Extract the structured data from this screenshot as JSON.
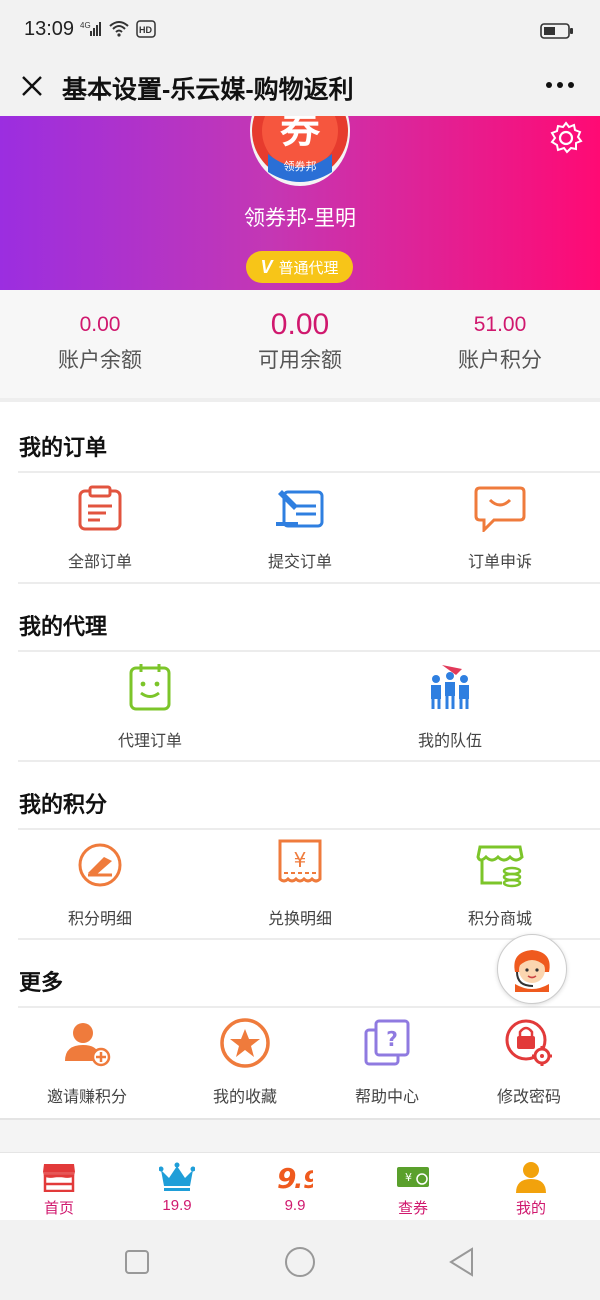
{
  "status_bar": {
    "time": "13:09",
    "network": "4G"
  },
  "nav": {
    "title": "基本设置-乐云媒-购物返利"
  },
  "profile": {
    "avatar_text": "券",
    "avatar_caption": "领券邦",
    "username": "领券邦-里明",
    "level_icon": "V",
    "level": "普通代理"
  },
  "stats": [
    {
      "value": "0.00",
      "label": "账户余额"
    },
    {
      "value": "0.00",
      "label": "可用余额"
    },
    {
      "value": "51.00",
      "label": "账户积分"
    }
  ],
  "orders": {
    "title": "我的订单",
    "items": [
      {
        "label": "全部订单",
        "icon": "clipboard-icon"
      },
      {
        "label": "提交订单",
        "icon": "submit-order-icon"
      },
      {
        "label": "订单申诉",
        "icon": "chat-bubble-icon"
      }
    ]
  },
  "agent": {
    "title": "我的代理",
    "items": [
      {
        "label": "代理订单",
        "icon": "agent-order-icon"
      },
      {
        "label": "我的队伍",
        "icon": "team-icon"
      }
    ]
  },
  "points": {
    "title": "我的积分",
    "items": [
      {
        "label": "积分明细",
        "icon": "points-detail-icon"
      },
      {
        "label": "兑换明细",
        "icon": "yen-ticket-icon"
      },
      {
        "label": "积分商城",
        "icon": "store-icon"
      }
    ]
  },
  "more": {
    "title": "更多",
    "items": [
      {
        "label": "邀请赚积分",
        "icon": "invite-user-icon"
      },
      {
        "label": "我的收藏",
        "icon": "star-icon"
      },
      {
        "label": "帮助中心",
        "icon": "help-icon"
      },
      {
        "label": "修改密码",
        "icon": "lock-icon"
      }
    ]
  },
  "tabs": [
    {
      "label": "首页",
      "icon": "shop-icon"
    },
    {
      "label": "19.9",
      "icon": "crown-icon"
    },
    {
      "label": "9.9",
      "icon": "nine-nine-icon"
    },
    {
      "label": "查券",
      "icon": "coupon-icon"
    },
    {
      "label": "我的",
      "icon": "user-icon"
    }
  ],
  "colors": {
    "accent": "#d0186e",
    "gradient_start": "#9b2ee0",
    "gradient_end": "#ff0a74",
    "badge": "#f7c518"
  }
}
